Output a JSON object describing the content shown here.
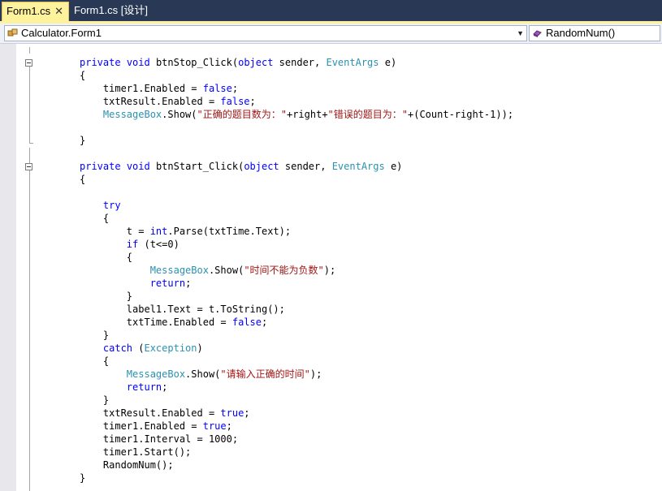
{
  "tabs": {
    "active": {
      "label": "Form1.cs",
      "close": "✕"
    },
    "inactive": {
      "label": "Form1.cs [设计]"
    }
  },
  "navbar": {
    "class_combo": "Calculator.Form1",
    "member_combo": "RandomNum()"
  },
  "colors": {
    "keyword": "#0000ff",
    "type": "#2b91af",
    "string": "#a31515",
    "tab_active": "#fff29d",
    "tab_strip": "#293955"
  },
  "code_lines": [
    {
      "tokens": [
        {
          "t": "private",
          "c": "kw"
        },
        {
          "t": " "
        },
        {
          "t": "void",
          "c": "kw"
        },
        {
          "t": " btnStop_Click("
        },
        {
          "t": "object",
          "c": "kw"
        },
        {
          "t": " sender, "
        },
        {
          "t": "EventArgs",
          "c": "ty"
        },
        {
          "t": " e)"
        }
      ]
    },
    {
      "tokens": [
        {
          "t": "{"
        }
      ]
    },
    {
      "tokens": [
        {
          "t": "    timer1.Enabled = "
        },
        {
          "t": "false",
          "c": "kw"
        },
        {
          "t": ";"
        }
      ]
    },
    {
      "tokens": [
        {
          "t": "    txtResult.Enabled = "
        },
        {
          "t": "false",
          "c": "kw"
        },
        {
          "t": ";"
        }
      ]
    },
    {
      "tokens": [
        {
          "t": "    "
        },
        {
          "t": "MessageBox",
          "c": "ty"
        },
        {
          "t": ".Show("
        },
        {
          "t": "\"正确的题目数为：\"",
          "c": "str"
        },
        {
          "t": "+right+"
        },
        {
          "t": "\"错误的题目为：\"",
          "c": "str"
        },
        {
          "t": "+(Count-right-1));"
        }
      ]
    },
    {
      "tokens": []
    },
    {
      "tokens": [
        {
          "t": "}"
        }
      ]
    },
    {
      "tokens": []
    },
    {
      "tokens": [
        {
          "t": "private",
          "c": "kw"
        },
        {
          "t": " "
        },
        {
          "t": "void",
          "c": "kw"
        },
        {
          "t": " btnStart_Click("
        },
        {
          "t": "object",
          "c": "kw"
        },
        {
          "t": " sender, "
        },
        {
          "t": "EventArgs",
          "c": "ty"
        },
        {
          "t": " e)"
        }
      ]
    },
    {
      "tokens": [
        {
          "t": "{"
        }
      ]
    },
    {
      "tokens": []
    },
    {
      "tokens": [
        {
          "t": "    "
        },
        {
          "t": "try",
          "c": "kw"
        }
      ]
    },
    {
      "tokens": [
        {
          "t": "    {"
        }
      ]
    },
    {
      "tokens": [
        {
          "t": "        t = "
        },
        {
          "t": "int",
          "c": "kw"
        },
        {
          "t": ".Parse(txtTime.Text);"
        }
      ]
    },
    {
      "tokens": [
        {
          "t": "        "
        },
        {
          "t": "if",
          "c": "kw"
        },
        {
          "t": " (t<=0)"
        }
      ]
    },
    {
      "tokens": [
        {
          "t": "        {"
        }
      ]
    },
    {
      "tokens": [
        {
          "t": "            "
        },
        {
          "t": "MessageBox",
          "c": "ty"
        },
        {
          "t": ".Show("
        },
        {
          "t": "\"时间不能为负数\"",
          "c": "str"
        },
        {
          "t": ");"
        }
      ]
    },
    {
      "tokens": [
        {
          "t": "            "
        },
        {
          "t": "return",
          "c": "kw"
        },
        {
          "t": ";"
        }
      ]
    },
    {
      "tokens": [
        {
          "t": "        }"
        }
      ]
    },
    {
      "tokens": [
        {
          "t": "        label1.Text = t.ToString();"
        }
      ]
    },
    {
      "tokens": [
        {
          "t": "        txtTime.Enabled = "
        },
        {
          "t": "false",
          "c": "kw"
        },
        {
          "t": ";"
        }
      ]
    },
    {
      "tokens": [
        {
          "t": "    }"
        }
      ]
    },
    {
      "tokens": [
        {
          "t": "    "
        },
        {
          "t": "catch",
          "c": "kw"
        },
        {
          "t": " ("
        },
        {
          "t": "Exception",
          "c": "ty"
        },
        {
          "t": ")"
        }
      ]
    },
    {
      "tokens": [
        {
          "t": "    {"
        }
      ]
    },
    {
      "tokens": [
        {
          "t": "        "
        },
        {
          "t": "MessageBox",
          "c": "ty"
        },
        {
          "t": ".Show("
        },
        {
          "t": "\"请输入正确的时间\"",
          "c": "str"
        },
        {
          "t": ");"
        }
      ]
    },
    {
      "tokens": [
        {
          "t": "        "
        },
        {
          "t": "return",
          "c": "kw"
        },
        {
          "t": ";"
        }
      ]
    },
    {
      "tokens": [
        {
          "t": "    }"
        }
      ]
    },
    {
      "tokens": [
        {
          "t": "    txtResult.Enabled = "
        },
        {
          "t": "true",
          "c": "kw"
        },
        {
          "t": ";"
        }
      ]
    },
    {
      "tokens": [
        {
          "t": "    timer1.Enabled = "
        },
        {
          "t": "true",
          "c": "kw"
        },
        {
          "t": ";"
        }
      ]
    },
    {
      "tokens": [
        {
          "t": "    timer1.Interval = 1000;"
        }
      ]
    },
    {
      "tokens": [
        {
          "t": "    timer1.Start();"
        }
      ]
    },
    {
      "tokens": [
        {
          "t": "    RandomNum();"
        }
      ]
    },
    {
      "tokens": [
        {
          "t": "}"
        }
      ]
    }
  ]
}
